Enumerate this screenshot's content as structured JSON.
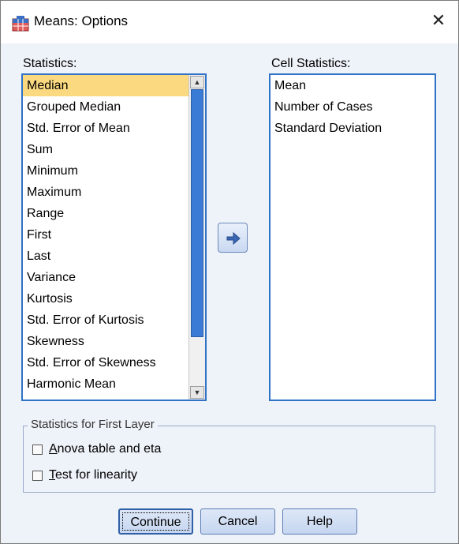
{
  "window": {
    "title": "Means: Options",
    "close": "✕"
  },
  "statistics": {
    "label": "Statistics:",
    "items": [
      "Median",
      "Grouped Median",
      "Std. Error of Mean",
      "Sum",
      "Minimum",
      "Maximum",
      "Range",
      "First",
      "Last",
      "Variance",
      "Kurtosis",
      "Std. Error of Kurtosis",
      "Skewness",
      "Std. Error of Skewness",
      "Harmonic Mean"
    ],
    "selected": "Median"
  },
  "cell_statistics": {
    "label": "Cell Statistics:",
    "items": [
      "Mean",
      "Number of Cases",
      "Standard Deviation"
    ]
  },
  "first_layer": {
    "legend": "Statistics for First Layer",
    "anova": "Anova table and eta",
    "linearity": "Test for linearity"
  },
  "buttons": {
    "continue": "Continue",
    "cancel": "Cancel",
    "help": "Help"
  }
}
